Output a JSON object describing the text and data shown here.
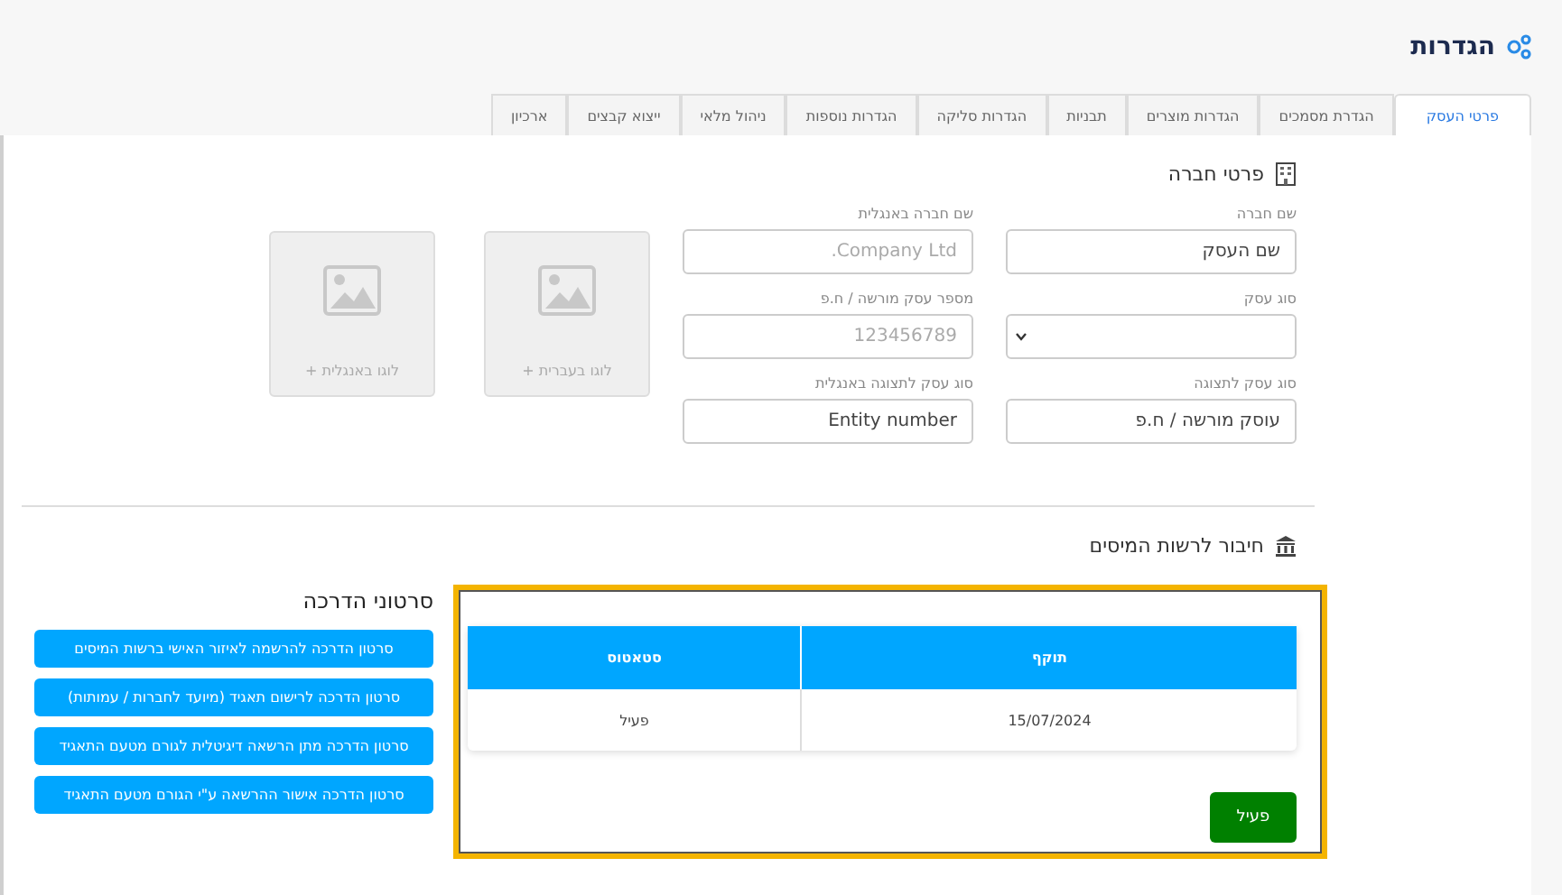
{
  "header": {
    "title": "הגדרות"
  },
  "tabs": [
    {
      "label": "פרטי העסק",
      "selected": true
    },
    {
      "label": "הגדרת מסמכים",
      "selected": false
    },
    {
      "label": "הגדרות מוצרים",
      "selected": false
    },
    {
      "label": "תבניות",
      "selected": false
    },
    {
      "label": "הגדרות סליקה",
      "selected": false
    },
    {
      "label": "הגדרות נוספות",
      "selected": false
    },
    {
      "label": "ניהול מלאי",
      "selected": false
    },
    {
      "label": "ייצוא קבצים",
      "selected": false
    },
    {
      "label": "ארכיון",
      "selected": false
    }
  ],
  "company_section": {
    "title": "פרטי חברה",
    "fields": [
      {
        "label": "שם חברה",
        "kind": "text",
        "value": "שם העסק"
      },
      {
        "label": "שם חברה באנגלית",
        "kind": "text",
        "placeholder": "Company Ltd."
      },
      {
        "label": "סוג עסק",
        "kind": "select"
      },
      {
        "label": "מספר עסק מורשה / ח.פ",
        "kind": "text",
        "placeholder": "123456789"
      },
      {
        "label": "סוג עסק לתצוגה",
        "kind": "text",
        "value": "עוסק מורשה / ח.פ"
      },
      {
        "label": "סוג עסק לתצוגה באנגלית",
        "kind": "text",
        "value": "Entity number"
      }
    ],
    "logos": [
      {
        "label": "לוגו בעברית +"
      },
      {
        "label": "לוגו באנגלית +"
      }
    ]
  },
  "tax_section": {
    "title": "חיבור לרשות המיסים",
    "table": {
      "columns": [
        "תוקף",
        "סטאטוס"
      ],
      "rows": [
        [
          "15/07/2024",
          "פעיל"
        ]
      ]
    },
    "status_button": "פעיל"
  },
  "videos": {
    "title": "סרטוני הדרכה",
    "buttons": [
      "סרטון הדרכה להרשמה לאיזור האישי ברשות המיסים",
      "סרטון הדרכה לרישום תאגיד (מיועד לחברות / עמותות)",
      "סרטון הדרכה מתן הרשאה דיגיטלית לגורם מטעם התאגיד",
      "סרטון הדרכה אישור ההרשאה ע\"י הגורם מטעם התאגיד"
    ]
  }
}
